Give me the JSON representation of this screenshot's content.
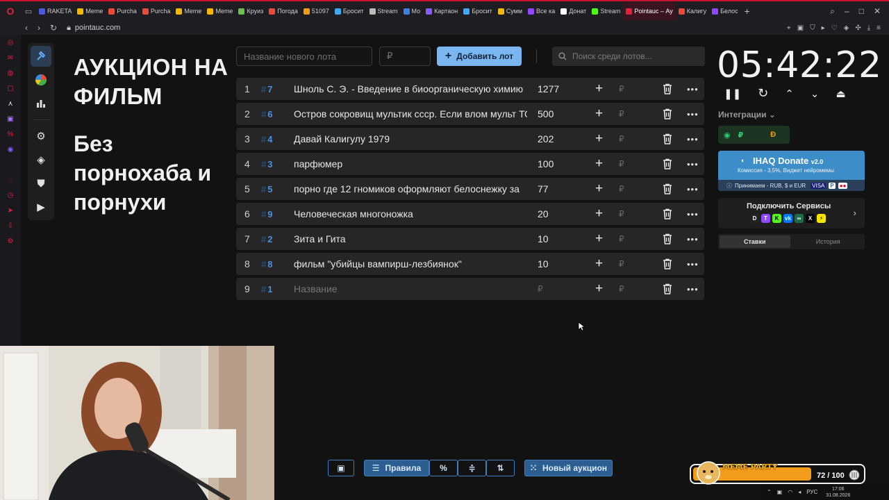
{
  "browser": {
    "tabs": [
      "RAKETA",
      "Meme",
      "Purcha",
      "Purcha",
      "Meme",
      "Meme",
      "Круиз",
      "Погода",
      "51097",
      "Бросит",
      "Stream",
      "Мо",
      "Картаон",
      "Бросит",
      "Сумм",
      "Все ка",
      "Донат",
      "Stream",
      "Pointauc – Ау",
      "Калигу",
      "Белос"
    ],
    "active_tab_index": 18,
    "url": "pointauc.com"
  },
  "page": {
    "heading": "АУКЦИОН НА ФИЛЬМ",
    "subheading": "Без порнохаба и порнухи"
  },
  "top": {
    "name_placeholder": "Название нового лота",
    "amount_placeholder": "₽",
    "add_button": "Добавить лот",
    "search_placeholder": "Поиск среди лотов..."
  },
  "lots": [
    {
      "idx": "1",
      "fast": "7",
      "name": "Шноль С. Э. - Введение в биоорганическую химию",
      "amount": "1277"
    },
    {
      "idx": "2",
      "fast": "6",
      "name": "Остров сокровищ мультик ссср. Если влом мульт ТО",
      "amount": "500"
    },
    {
      "idx": "3",
      "fast": "4",
      "name": "Давай Калигулу 1979",
      "amount": "202"
    },
    {
      "idx": "4",
      "fast": "3",
      "name": "парфюмер",
      "amount": "100"
    },
    {
      "idx": "5",
      "fast": "5",
      "name": "порно где 12 гномиков оформляют белоснежку за",
      "amount": "77"
    },
    {
      "idx": "6",
      "fast": "9",
      "name": "Человеческая многоножка",
      "amount": "20"
    },
    {
      "idx": "7",
      "fast": "2",
      "name": "Зита и Гита",
      "amount": "10"
    },
    {
      "idx": "8",
      "fast": "8",
      "name": "фильм \"убийцы вампирш-лезбиянок\"",
      "amount": "10"
    },
    {
      "idx": "9",
      "fast": "1",
      "name": "Название",
      "amount": "₽",
      "placeholder": true
    }
  ],
  "lot_rub_symbol": "₽",
  "timer": "05:42:22",
  "integrations": {
    "label": "Интеграции",
    "donate_title": "IHAQ Donate",
    "donate_version": "v2.0",
    "donate_desc": "Комиссия - 3,5%, Виджет нейромемы",
    "donate_accept": "Принимаем - RUB, $ и EUR",
    "connect_label": "Подключить Сервисы"
  },
  "side_tabs": [
    "Ставки",
    "История"
  ],
  "bottom": {
    "rules": "Правила",
    "new_auction": "Новый аукцион"
  },
  "meme": {
    "title": "MEME PARTY",
    "progress": "72 / 100",
    "progress_fraction": 0.72
  },
  "tray": {
    "lang": "РУС",
    "time": "17:06",
    "date": "31.08.2026"
  },
  "colors": {
    "accent": "#7ab7f0",
    "fast_id": "#4d8fd8",
    "row_bg": "#262626",
    "page_bg": "#121212",
    "brand_red": "#e0223a"
  }
}
